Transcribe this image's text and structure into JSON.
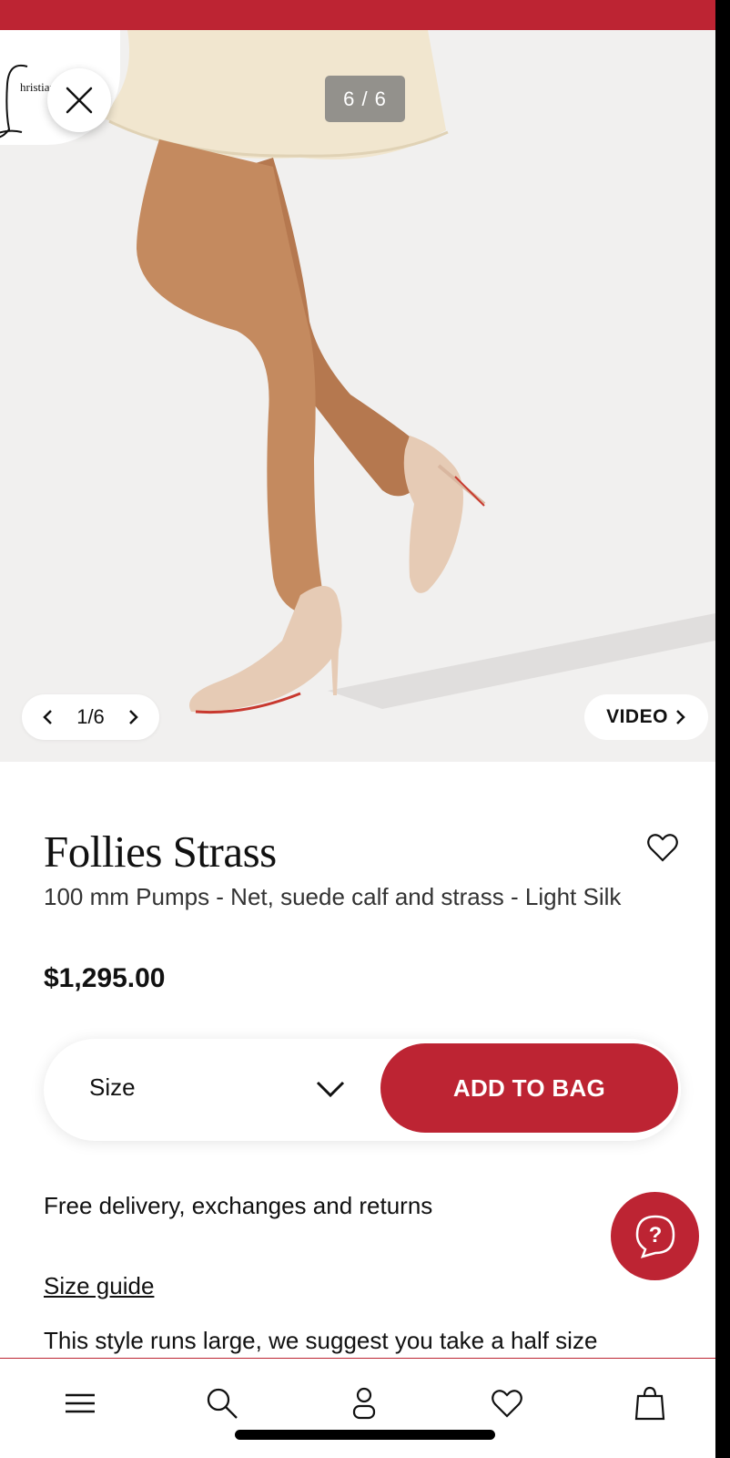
{
  "colors": {
    "accent": "#bd2433",
    "hero_bg": "#f1f0ef"
  },
  "brand": {
    "logo_text": "hristian"
  },
  "gallery": {
    "counter_top": "6 / 6",
    "pager_text": "1/6",
    "video_label": "VIDEO"
  },
  "product": {
    "name": "Follies Strass",
    "description": "100 mm Pumps - Net, suede calf and strass - Light Silk",
    "price": "$1,295.00"
  },
  "purchase": {
    "size_label": "Size",
    "add_to_bag_label": "ADD TO BAG"
  },
  "info": {
    "delivery": "Free delivery, exchanges and returns",
    "size_guide": "Size guide",
    "size_note": "This style runs large, we suggest you take a half size"
  },
  "icons": {
    "close": "close-icon",
    "prev": "chevron-left-icon",
    "next": "chevron-right-icon",
    "wishlist": "heart-icon",
    "size_dropdown": "chevron-down-icon",
    "help": "chat-help-icon",
    "tabs": [
      "menu-icon",
      "search-icon",
      "account-icon",
      "heart-icon",
      "bag-icon"
    ]
  }
}
